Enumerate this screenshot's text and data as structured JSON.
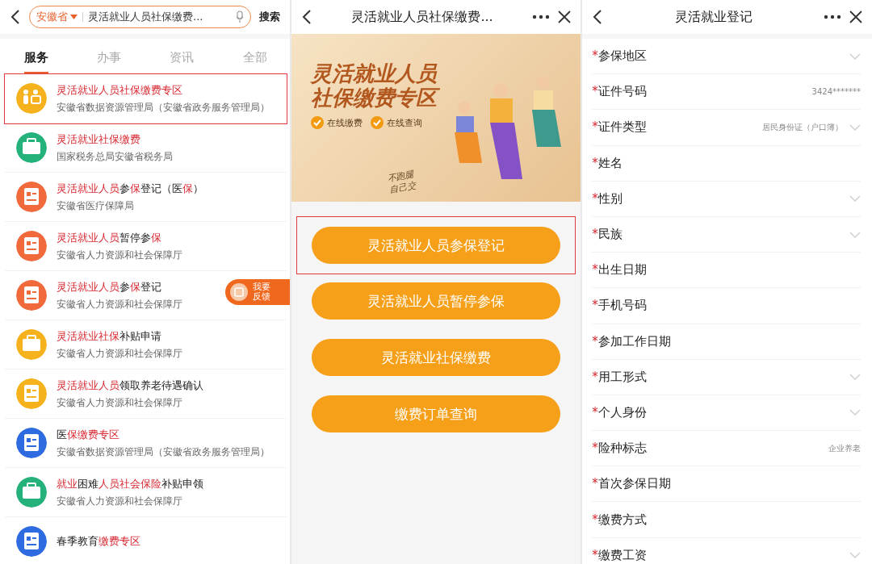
{
  "search_screen": {
    "search": {
      "region": "安徽省",
      "query": "灵活就业人员社保缴费...",
      "button": "搜索"
    },
    "tabs": [
      {
        "label": "服务",
        "selected": true
      },
      {
        "label": "办事",
        "selected": false
      },
      {
        "label": "资讯",
        "selected": false
      },
      {
        "label": "全部",
        "selected": false
      }
    ],
    "results": [
      {
        "kind": "people",
        "color": "#f5b21c",
        "annotated": true,
        "title_parts": [
          {
            "text": "灵活就业人员社保缴费专区",
            "highlight": true
          }
        ],
        "subtitle": "安徽省数据资源管理局（安徽省政务服务管理局）"
      },
      {
        "kind": "briefcase",
        "color": "#25b27a",
        "annotated": false,
        "title_parts": [
          {
            "text": "灵活就业社保缴费",
            "highlight": true
          }
        ],
        "subtitle": "国家税务总局安徽省税务局"
      },
      {
        "kind": "document",
        "color": "#f06a3c",
        "annotated": false,
        "title_parts": [
          {
            "text": "灵活就业人员",
            "highlight": true
          },
          {
            "text": "参",
            "highlight": false
          },
          {
            "text": "保",
            "highlight": true
          },
          {
            "text": "登记（医",
            "highlight": false
          },
          {
            "text": "保",
            "highlight": true
          },
          {
            "text": "）",
            "highlight": false
          }
        ],
        "subtitle": "安徽省医疗保障局"
      },
      {
        "kind": "document",
        "color": "#f06a3c",
        "annotated": false,
        "title_parts": [
          {
            "text": "灵活就业人员",
            "highlight": true
          },
          {
            "text": "暂停参",
            "highlight": false
          },
          {
            "text": "保",
            "highlight": true
          }
        ],
        "subtitle": "安徽省人力资源和社会保障厅"
      },
      {
        "kind": "document",
        "color": "#f06a3c",
        "annotated": false,
        "title_parts": [
          {
            "text": "灵活就业人员",
            "highlight": true
          },
          {
            "text": "参",
            "highlight": false
          },
          {
            "text": "保",
            "highlight": true
          },
          {
            "text": "登记",
            "highlight": false
          }
        ],
        "subtitle": "安徽省人力资源和社会保障厅"
      },
      {
        "kind": "briefcase",
        "color": "#f5b21c",
        "annotated": false,
        "title_parts": [
          {
            "text": "灵活就业社保",
            "highlight": true
          },
          {
            "text": "补贴申请",
            "highlight": false
          }
        ],
        "subtitle": "安徽省人力资源和社会保障厅"
      },
      {
        "kind": "document",
        "color": "#f5b21c",
        "annotated": false,
        "title_parts": [
          {
            "text": "灵活就业人员",
            "highlight": true
          },
          {
            "text": "领取养老待遇确认",
            "highlight": false
          }
        ],
        "subtitle": "安徽省人力资源和社会保障厅"
      },
      {
        "kind": "document",
        "color": "#2f6be0",
        "annotated": false,
        "title_parts": [
          {
            "text": "医",
            "highlight": false
          },
          {
            "text": "保缴费专区",
            "highlight": true
          }
        ],
        "subtitle": "安徽省数据资源管理局（安徽省政务服务管理局）"
      },
      {
        "kind": "briefcase",
        "color": "#25b27a",
        "annotated": false,
        "title_parts": [
          {
            "text": "就业",
            "highlight": true
          },
          {
            "text": "困难",
            "highlight": false
          },
          {
            "text": "人员社会保险",
            "highlight": true
          },
          {
            "text": "补贴申领",
            "highlight": false
          }
        ],
        "subtitle": "安徽省人力资源和社会保障厅"
      },
      {
        "kind": "document",
        "color": "#2f6be0",
        "annotated": false,
        "title_parts": [
          {
            "text": "春季教育",
            "highlight": false
          },
          {
            "text": "缴费专区",
            "highlight": true
          }
        ]
      }
    ],
    "feedback_button": {
      "line_1": "我要",
      "line_2": "反馈"
    }
  },
  "zone_screen": {
    "title": "灵活就业人员社保缴费...",
    "banner": {
      "title_line_1": "灵活就业人员",
      "title_line_2": "社保缴费专区",
      "features": [
        "在线缴费",
        "在线查询"
      ],
      "slogan_line_1": "不跑腿",
      "slogan_line_2": "自己交"
    },
    "buttons": [
      {
        "label": "灵活就业人员参保登记",
        "annotated": true
      },
      {
        "label": "灵活就业人员暂停参保",
        "annotated": false
      },
      {
        "label": "灵活就业社保缴费",
        "annotated": false
      },
      {
        "label": "缴费订单查询",
        "annotated": false
      }
    ]
  },
  "form_screen": {
    "title": "灵活就业登记",
    "required_marker": "*",
    "fields": [
      {
        "label": "参保地区",
        "kind": "select",
        "required": true
      },
      {
        "label": "证件号码",
        "kind": "text",
        "required": true,
        "value": "3424*******"
      },
      {
        "label": "证件类型",
        "kind": "select",
        "required": true,
        "value": "居民身份证（户口簿）"
      },
      {
        "label": "姓名",
        "kind": "text",
        "required": true
      },
      {
        "label": "性别",
        "kind": "select",
        "required": true
      },
      {
        "label": "民族",
        "kind": "select",
        "required": true
      },
      {
        "label": "出生日期",
        "kind": "text",
        "required": true
      },
      {
        "label": "手机号码",
        "kind": "text",
        "required": true
      },
      {
        "label": "参加工作日期",
        "kind": "text",
        "required": true
      },
      {
        "label": "用工形式",
        "kind": "select",
        "required": true
      },
      {
        "label": "个人身份",
        "kind": "select",
        "required": true
      },
      {
        "label": "险种标志",
        "kind": "text",
        "required": true,
        "value": "企业养老"
      },
      {
        "label": "首次参保日期",
        "kind": "text",
        "required": true
      },
      {
        "label": "缴费方式",
        "kind": "text",
        "required": true
      },
      {
        "label": "缴费工资",
        "kind": "select",
        "required": true
      }
    ]
  }
}
